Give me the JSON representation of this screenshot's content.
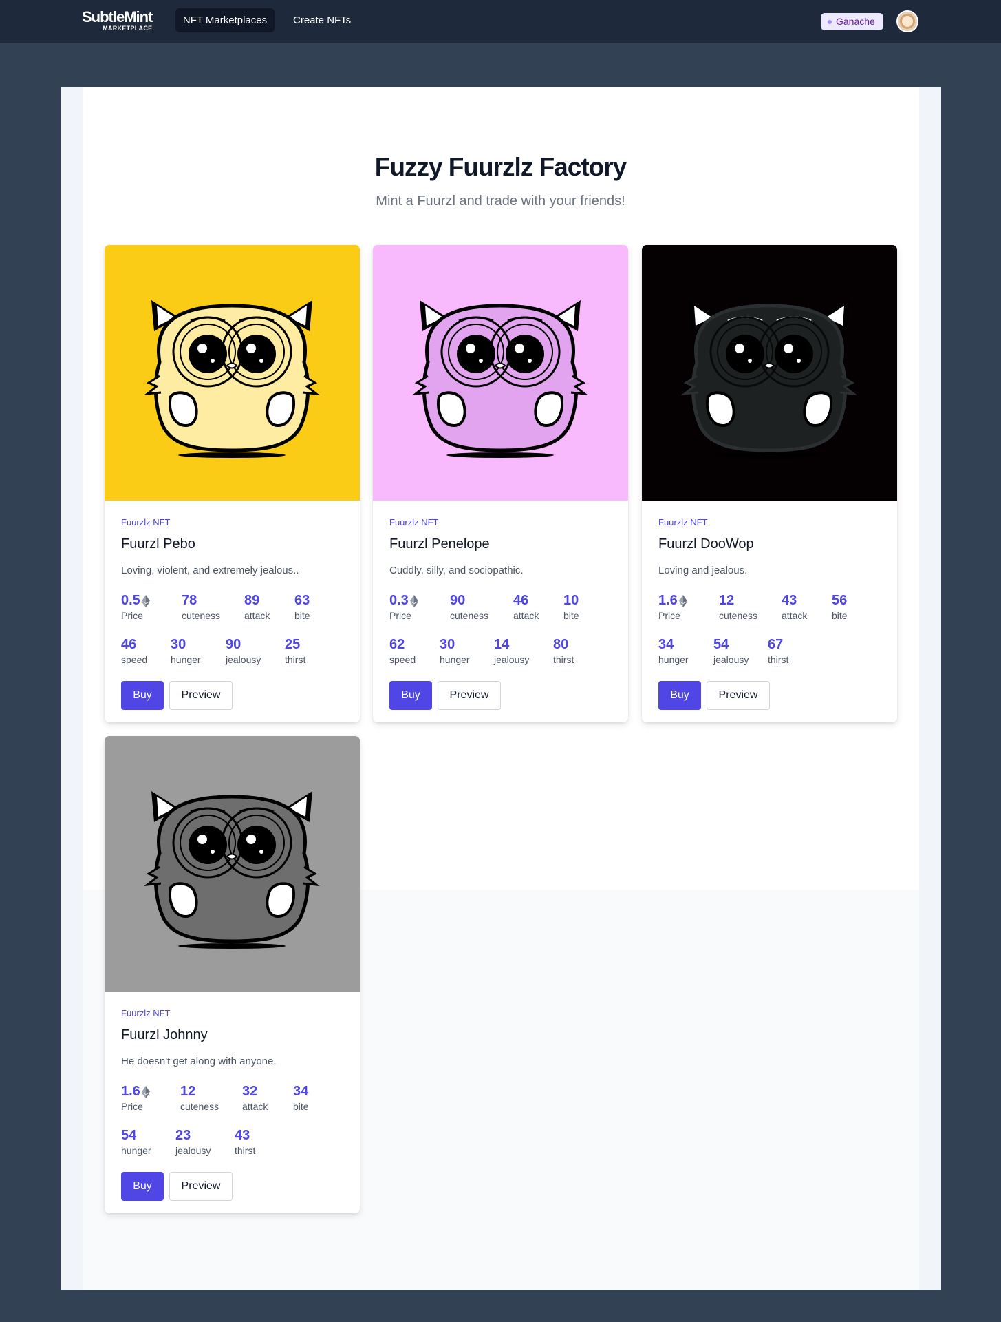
{
  "nav": {
    "logo_main": "SubtleMint",
    "logo_sub": "MARKETPLACE",
    "marketplaces_label": "NFT Marketplaces",
    "create_label": "Create NFTs",
    "network_label": "Ganache"
  },
  "header": {
    "title": "Fuzzy Fuurzlz Factory",
    "subtitle": "Mint a Fuurzl and trade with your friends!"
  },
  "labels": {
    "buy": "Buy",
    "preview": "Preview"
  },
  "cards": [
    {
      "tag": "Fuurzlz NFT",
      "name": "Fuurzl Pebo",
      "description": "Loving, violent, and extremely jealous..",
      "bg_color": "#facc15",
      "body_color": "#fdeca2",
      "stats_row1": [
        {
          "value": "0.5",
          "label": "Price"
        },
        {
          "value": "78",
          "label": "cuteness"
        },
        {
          "value": "89",
          "label": "attack"
        },
        {
          "value": "63",
          "label": "bite"
        }
      ],
      "stats_row2": [
        {
          "value": "46",
          "label": "speed"
        },
        {
          "value": "30",
          "label": "hunger"
        },
        {
          "value": "90",
          "label": "jealousy"
        },
        {
          "value": "25",
          "label": "thirst"
        }
      ]
    },
    {
      "tag": "Fuurzlz NFT",
      "name": "Fuurzl Penelope",
      "description": "Cuddly, silly, and sociopathic.",
      "bg_color": "#f8b9fd",
      "body_color": "#e2a3ef",
      "stats_row1": [
        {
          "value": "0.3",
          "label": "Price"
        },
        {
          "value": "90",
          "label": "cuteness"
        },
        {
          "value": "46",
          "label": "attack"
        },
        {
          "value": "10",
          "label": "bite"
        }
      ],
      "stats_row2": [
        {
          "value": "62",
          "label": "speed"
        },
        {
          "value": "30",
          "label": "hunger"
        },
        {
          "value": "14",
          "label": "jealousy"
        },
        {
          "value": "80",
          "label": "thirst"
        }
      ]
    },
    {
      "tag": "Fuurzlz NFT",
      "name": "Fuurzl DooWop",
      "description": "Loving and jealous.",
      "bg_color": "#050102",
      "body_color": "#1d2122",
      "stats_row1": [
        {
          "value": "1.6",
          "label": "Price"
        },
        {
          "value": "12",
          "label": "cuteness"
        },
        {
          "value": "43",
          "label": "attack"
        },
        {
          "value": "56",
          "label": "bite"
        }
      ],
      "stats_row2": [
        {
          "value": "34",
          "label": "hunger"
        },
        {
          "value": "54",
          "label": "jealousy"
        },
        {
          "value": "67",
          "label": "thirst"
        }
      ]
    },
    {
      "tag": "Fuurzlz NFT",
      "name": "Fuurzl Johnny",
      "description": "He doesn't get along with anyone.",
      "bg_color": "#9c9c9c",
      "body_color": "#6e6e6e",
      "stats_row1": [
        {
          "value": "1.6",
          "label": "Price"
        },
        {
          "value": "12",
          "label": "cuteness"
        },
        {
          "value": "32",
          "label": "attack"
        },
        {
          "value": "34",
          "label": "bite"
        }
      ],
      "stats_row2": [
        {
          "value": "54",
          "label": "hunger"
        },
        {
          "value": "23",
          "label": "jealousy"
        },
        {
          "value": "43",
          "label": "thirst"
        }
      ]
    }
  ],
  "colors": {
    "accent": "#4f46e5",
    "topbar": "#1e293b",
    "page_bg": "#334155"
  },
  "icons": [
    "ethereum-icon"
  ]
}
